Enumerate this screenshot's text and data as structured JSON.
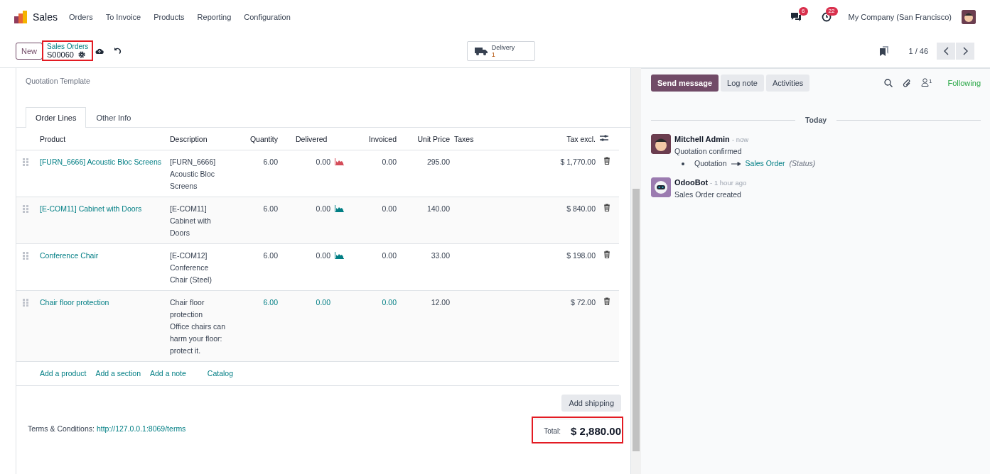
{
  "app": {
    "name": "Sales"
  },
  "menu": [
    "Orders",
    "To Invoice",
    "Products",
    "Reporting",
    "Configuration"
  ],
  "systray": {
    "messages_count": "6",
    "activities_count": "22",
    "company": "My Company (San Francisco)"
  },
  "control_panel": {
    "new_button": "New",
    "breadcrumb": "Sales Orders",
    "record": "S00060",
    "smart_button": {
      "label": "Delivery",
      "count": "1"
    },
    "pager": "1 / 46"
  },
  "form": {
    "quotation_template_label": "Quotation Template",
    "tabs": [
      {
        "label": "Order Lines",
        "selected": true
      },
      {
        "label": "Other Info",
        "selected": false
      }
    ],
    "columns": [
      "Product",
      "Description",
      "Quantity",
      "Delivered",
      "Invoiced",
      "Unit Price",
      "Taxes",
      "Tax excl."
    ],
    "rows": [
      {
        "kind": "storable",
        "product": "[FURN_6666] Acoustic Bloc Screens",
        "description": [
          "[FURN_6666]",
          "Acoustic Bloc",
          "Screens"
        ],
        "quantity": "6.00",
        "delivered": "0.00",
        "color": "#d44c59",
        "invoiced": "0.00",
        "unit_price": "295.00",
        "subtotal": "$ 1,770.00"
      },
      {
        "kind": "storable",
        "product": "[E-COM11] Cabinet with Doors",
        "description": [
          "[E-COM11]",
          "Cabinet with",
          "Doors"
        ],
        "quantity": "6.00",
        "delivered": "0.00",
        "color": "#017e84",
        "invoiced": "0.00",
        "unit_price": "140.00",
        "subtotal": "$ 840.00"
      },
      {
        "kind": "storable",
        "product": "Conference Chair",
        "description": [
          "[E-COM12]",
          "Conference",
          "Chair (Steel)"
        ],
        "quantity": "6.00",
        "delivered": "0.00",
        "color": "#017e84",
        "invoiced": "0.00",
        "unit_price": "33.00",
        "subtotal": "$ 198.00"
      },
      {
        "kind": "service",
        "product": "Chair floor protection",
        "description": [
          "Chair floor",
          "protection",
          "Office chairs can",
          "harm your floor:",
          "protect it."
        ],
        "quantity": "6.00",
        "delivered": "0.00",
        "invoiced": "0.00",
        "unit_price": "12.00",
        "subtotal": "$ 72.00"
      }
    ],
    "add_links": [
      "Add a product",
      "Add a section",
      "Add a note",
      "Catalog"
    ],
    "add_shipping": "Add shipping",
    "terms_label": "Terms & Conditions:",
    "terms_link": "http://127.0.0.1:8069/terms",
    "total_label": "Total:",
    "total": "$ 2,880.00"
  },
  "chatter": {
    "buttons": [
      {
        "label": "Send message",
        "selected": true
      },
      {
        "label": "Log note",
        "selected": false
      },
      {
        "label": "Activities",
        "selected": false
      }
    ],
    "followers_count": "1",
    "following": "Following",
    "date_separator": "Today",
    "messages": [
      {
        "kind": "admin",
        "author": "Mitchell Admin",
        "time": "- now",
        "body": "Quotation confirmed",
        "change": {
          "old": "Quotation",
          "new": "Sales Order",
          "field": "(Status)"
        }
      },
      {
        "kind": "bot",
        "author": "OdooBot",
        "time": "- 1 hour ago",
        "body": "Sales Order created"
      }
    ]
  }
}
